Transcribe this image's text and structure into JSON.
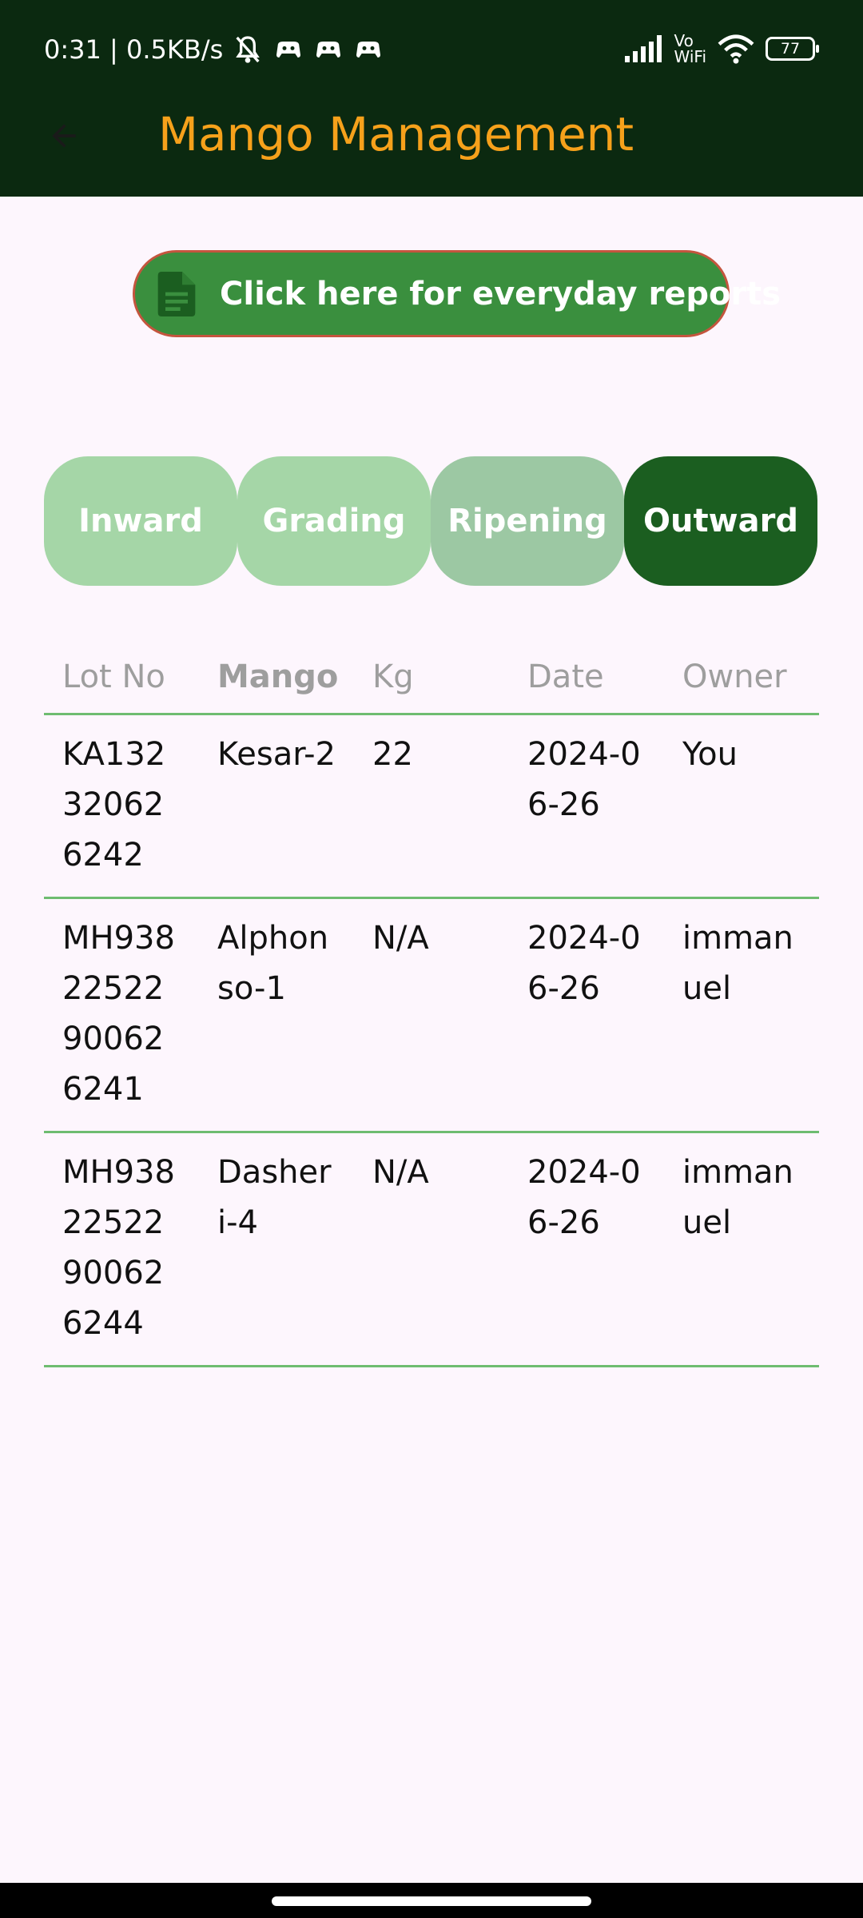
{
  "status_bar": {
    "time_speed": "0:31 | 0.5KB/s",
    "vowifi_top": "Vo",
    "vowifi_bottom": "WiFi",
    "battery": "77"
  },
  "header": {
    "title": "Mango Management"
  },
  "report_button": {
    "label": "Click here for everyday reports"
  },
  "tabs": [
    {
      "label": "Inward"
    },
    {
      "label": "Grading"
    },
    {
      "label": "Ripening"
    },
    {
      "label": "Outward"
    }
  ],
  "table": {
    "columns": [
      "Lot No",
      "Mango",
      "Kg",
      "Date",
      "Owner"
    ],
    "rows": [
      {
        "lot_no": "KA132320626242",
        "mango": "Kesar-2",
        "kg": "22",
        "date": "2024-06-26",
        "owner": "You"
      },
      {
        "lot_no": "MH93822522900626241",
        "mango": "Alphonso-1",
        "kg": "N/A",
        "date": "2024-06-26",
        "owner": "immanuel"
      },
      {
        "lot_no": "MH93822522900626244",
        "mango": "Dasheri-4",
        "kg": "N/A",
        "date": "2024-06-26",
        "owner": "immanuel"
      }
    ]
  },
  "colors": {
    "app_bar": "#0b2910",
    "title": "#f6a11b",
    "report_button": "#3a8f3e",
    "tab_active": "#1b5e20",
    "tab_inactive": "#a5d6a7",
    "divider": "#6ebc70"
  },
  "icons": {
    "back": "arrow-back-icon",
    "report": "document-icon",
    "mute": "bell-off-icon",
    "signal": "signal-icon",
    "wifi": "wifi-icon",
    "battery": "battery-icon"
  }
}
